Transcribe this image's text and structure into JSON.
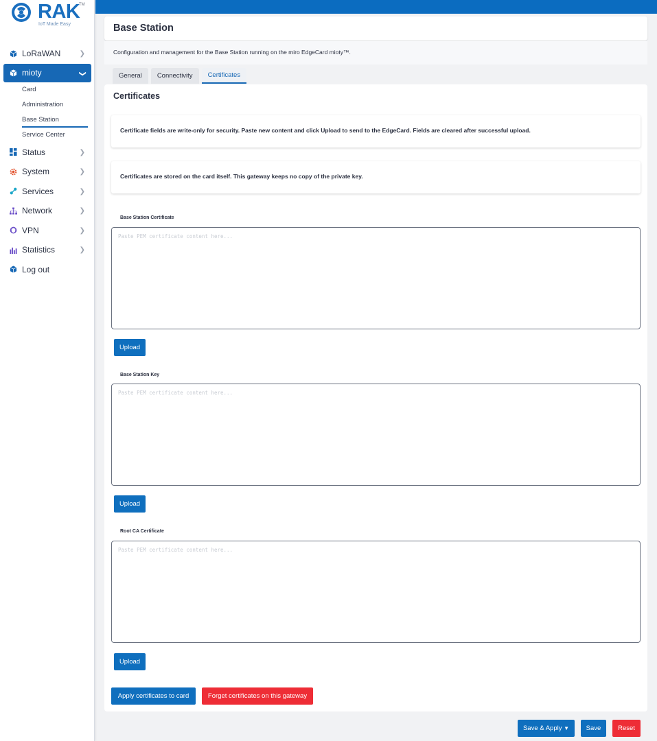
{
  "brand": {
    "name": "RAK",
    "tm": "TM",
    "tagline": "IoT Made Easy"
  },
  "nav": {
    "lorawan": "LoRaWAN",
    "mioty": "mioty",
    "mioty_sub": {
      "card": "Card",
      "administration": "Administration",
      "base_station": "Base Station",
      "service_center": "Service Center"
    },
    "status": "Status",
    "system": "System",
    "services": "Services",
    "network": "Network",
    "vpn": "VPN",
    "statistics": "Statistics",
    "logout": "Log out"
  },
  "header": {
    "title": "Base Station"
  },
  "description": "Configuration and management for the Base Station running on the miro EdgeCard mioty™.",
  "tabs": {
    "general": "General",
    "connectivity": "Connectivity",
    "certificates": "Certificates"
  },
  "section": {
    "title": "Certificates",
    "notice1": "Certificate fields are write-only for security. Paste new content and click Upload to send to the EdgeCard. Fields are cleared after successful upload.",
    "notice2": "Certificates are stored on the card itself. This gateway keeps no copy of the private key."
  },
  "fields": {
    "cert": {
      "label": "Base Station Certificate",
      "placeholder": "Paste PEM certificate content here...",
      "button": "Upload"
    },
    "key": {
      "label": "Base Station Key",
      "placeholder": "Paste PEM certificate content here...",
      "button": "Upload"
    },
    "ca": {
      "label": "Root CA Certificate",
      "placeholder": "Paste PEM certificate content here...",
      "button": "Upload"
    }
  },
  "actions": {
    "apply": "Apply certificates to card",
    "forget": "Forget certificates on this gateway"
  },
  "footer": {
    "save_apply": "Save & Apply",
    "save_apply_caret": "▼",
    "save": "Save",
    "reset": "Reset"
  },
  "colors": {
    "primary": "#0f6fbe",
    "danger": "#ee2d36",
    "topbar": "#0b6cc0"
  }
}
